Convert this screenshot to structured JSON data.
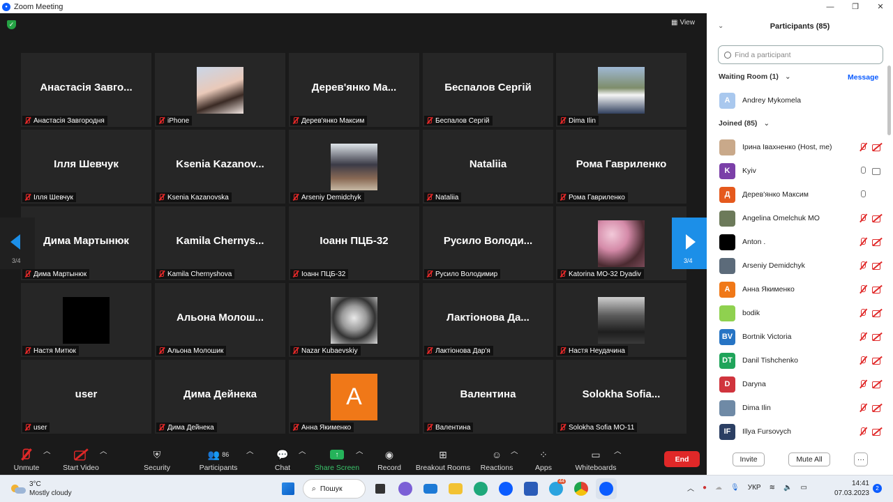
{
  "window": {
    "title": "Zoom Meeting"
  },
  "stage": {
    "view_label": "View"
  },
  "tiles": [
    {
      "big": "Анастасія Завго...",
      "label": "Анастасія Завгородня",
      "avatar": ""
    },
    {
      "big": "",
      "label": "iPhone",
      "avatar": "photo-girl"
    },
    {
      "big": "Дерев'янко Ма...",
      "label": "Дерев'янко Максим",
      "avatar": ""
    },
    {
      "big": "Беспалов Сергій",
      "label": "Беспалов Сергій",
      "avatar": ""
    },
    {
      "big": "",
      "label": "Dima Ilin",
      "avatar": "photo-man"
    },
    {
      "big": "Ілля Шевчук",
      "label": "Ілля Шевчук",
      "avatar": ""
    },
    {
      "big": "Ksenia  Kazanov...",
      "label": "Ksenia Kazanovska",
      "avatar": ""
    },
    {
      "big": "",
      "label": "Arseniy Demidchyk",
      "avatar": "photo-boat"
    },
    {
      "big": "Nataliia",
      "label": "Nataliia",
      "avatar": ""
    },
    {
      "big": "Рома Гавриленко",
      "label": "Рома Гавриленко",
      "avatar": ""
    },
    {
      "big": "Дима Мартынюк",
      "label": "Дима Мартынюк",
      "avatar": ""
    },
    {
      "big": "Kamila  Chernys...",
      "label": "Kamila Chernyshova",
      "avatar": ""
    },
    {
      "big": "Іоанн ПЦБ-32",
      "label": "Іоанн ПЦБ-32",
      "avatar": ""
    },
    {
      "big": "Русило  Володи...",
      "label": "Русило Володимир",
      "avatar": ""
    },
    {
      "big": "",
      "label": "Katorina MO-32 Dyadiv",
      "avatar": "photo-flowers"
    },
    {
      "big": "",
      "label": "Настя Митюк",
      "avatar": "black"
    },
    {
      "big": "Альона  Молош...",
      "label": "Альона Молошик",
      "avatar": ""
    },
    {
      "big": "",
      "label": "Nazar Kubaevskiy",
      "avatar": "photo-skull"
    },
    {
      "big": "Лактіонова  Да...",
      "label": "Лактіонова Дар'я",
      "avatar": ""
    },
    {
      "big": "",
      "label": "Настя Неудачина",
      "avatar": "photo-bw"
    },
    {
      "big": "user",
      "label": "user",
      "avatar": ""
    },
    {
      "big": "Дима Дейнека",
      "label": "Дима Дейнека",
      "avatar": ""
    },
    {
      "big": "",
      "label": "Анна Якименко",
      "avatar": "letter-a"
    },
    {
      "big": "Валентина",
      "label": "Валентина",
      "avatar": ""
    },
    {
      "big": "Solokha  Sofia...",
      "label": "Solokha Sofia MO-11",
      "avatar": ""
    }
  ],
  "tile_letter": "A",
  "pager": {
    "left": "3/4",
    "right": "3/4"
  },
  "toolbar": {
    "unmute": "Unmute",
    "start_video": "Start Video",
    "security": "Security",
    "participants": "Participants",
    "participants_count": "86",
    "chat": "Chat",
    "share": "Share Screen",
    "record": "Record",
    "breakout": "Breakout Rooms",
    "reactions": "Reactions",
    "apps": "Apps",
    "whiteboards": "Whiteboards",
    "end": "End"
  },
  "panel": {
    "title": "Participants (85)",
    "search_placeholder": "Find a participant",
    "waiting_room": "Waiting Room (1)",
    "message": "Message",
    "waiting": [
      {
        "name": "Andrey Mykomela",
        "initials": "A",
        "color": "#a9c8ee"
      }
    ],
    "joined_header": "Joined (85)",
    "joined": [
      {
        "name": "Ірина Івахненко (Host, me)",
        "initials": "",
        "color": "#c9a98a",
        "mic": "muted",
        "cam": "off"
      },
      {
        "name": "Kyiv",
        "initials": "K",
        "color": "#7b3fa8",
        "mic": "on",
        "cam": "on"
      },
      {
        "name": "Дерев'янко Максим",
        "initials": "Д",
        "color": "#e5591d",
        "mic": "on",
        "cam": "none"
      },
      {
        "name": "Angelina Omelchuk MO",
        "initials": "",
        "color": "#6c7a5a",
        "mic": "muted",
        "cam": "off"
      },
      {
        "name": "Anton .",
        "initials": "",
        "color": "#000000",
        "mic": "muted",
        "cam": "off"
      },
      {
        "name": "Arseniy Demidchyk",
        "initials": "",
        "color": "#5c6b7a",
        "mic": "muted",
        "cam": "off"
      },
      {
        "name": "Анна Якименко",
        "initials": "А",
        "color": "#f07818",
        "mic": "muted",
        "cam": "off"
      },
      {
        "name": "bodik",
        "initials": "",
        "color": "#8fd14f",
        "mic": "muted",
        "cam": "off"
      },
      {
        "name": "Bortnik Victoria",
        "initials": "BV",
        "color": "#2674c4",
        "mic": "muted",
        "cam": "off"
      },
      {
        "name": "Danil Tishchenko",
        "initials": "DT",
        "color": "#1fa45a",
        "mic": "muted",
        "cam": "off"
      },
      {
        "name": "Daryna",
        "initials": "D",
        "color": "#d0343d",
        "mic": "muted",
        "cam": "off"
      },
      {
        "name": "Dima Ilin",
        "initials": "",
        "color": "#6f8aa6",
        "mic": "muted",
        "cam": "off"
      },
      {
        "name": "Illya Fursovych",
        "initials": "IF",
        "color": "#2b3f63",
        "mic": "muted",
        "cam": "off"
      }
    ],
    "invite": "Invite",
    "mute_all": "Mute All",
    "more": "···"
  },
  "taskbar": {
    "temp": "3°C",
    "weather": "Mostly cloudy",
    "search": "Пошук",
    "lang": "УКР",
    "time": "14:41",
    "date": "07.03.2023",
    "notif": "2",
    "telegram_badge": "44"
  }
}
